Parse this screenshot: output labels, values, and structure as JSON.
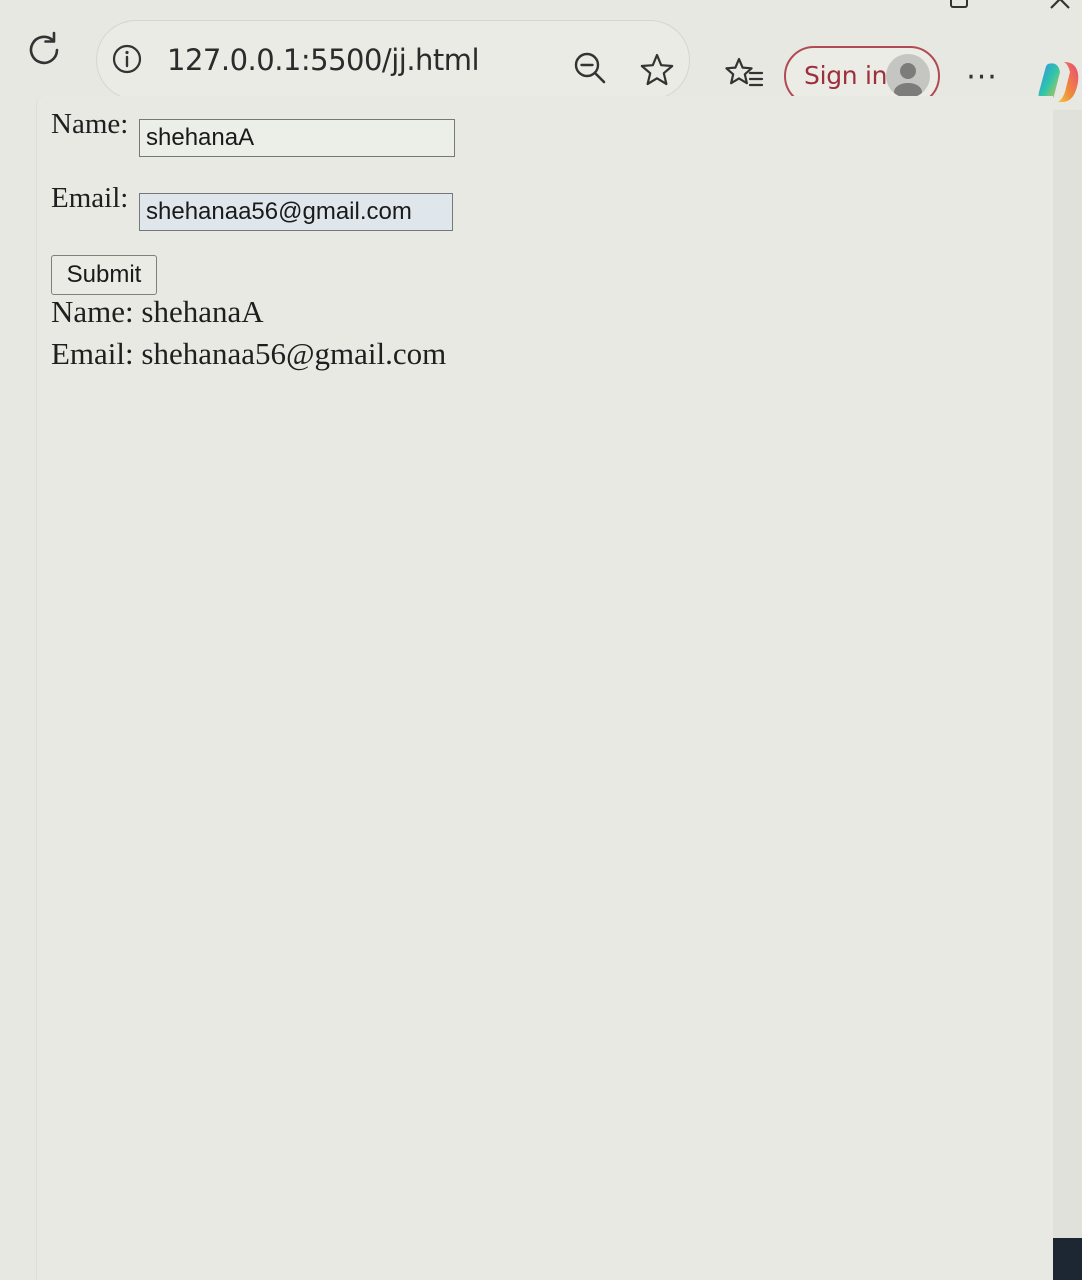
{
  "browser": {
    "url": "127.0.0.1:5500/jj.html",
    "sign_in_label": "Sign in",
    "more_menu_glyph": "···",
    "icons": [
      "reload-icon",
      "info-icon",
      "zoom-out-icon",
      "favorite-star-icon",
      "favorites-icon",
      "avatar",
      "more-icon",
      "copilot-icon",
      "restore-icon",
      "close-icon"
    ],
    "accent_color": "#b24a55"
  },
  "form": {
    "name_label": "Name:",
    "name_value": "shehanaA",
    "email_label": "Email:",
    "email_value": "shehanaa56@gmail.com",
    "submit_label": "Submit"
  },
  "output": {
    "name_line": "Name: shehanaA",
    "email_line": "Email: shehanaa56@gmail.com"
  }
}
